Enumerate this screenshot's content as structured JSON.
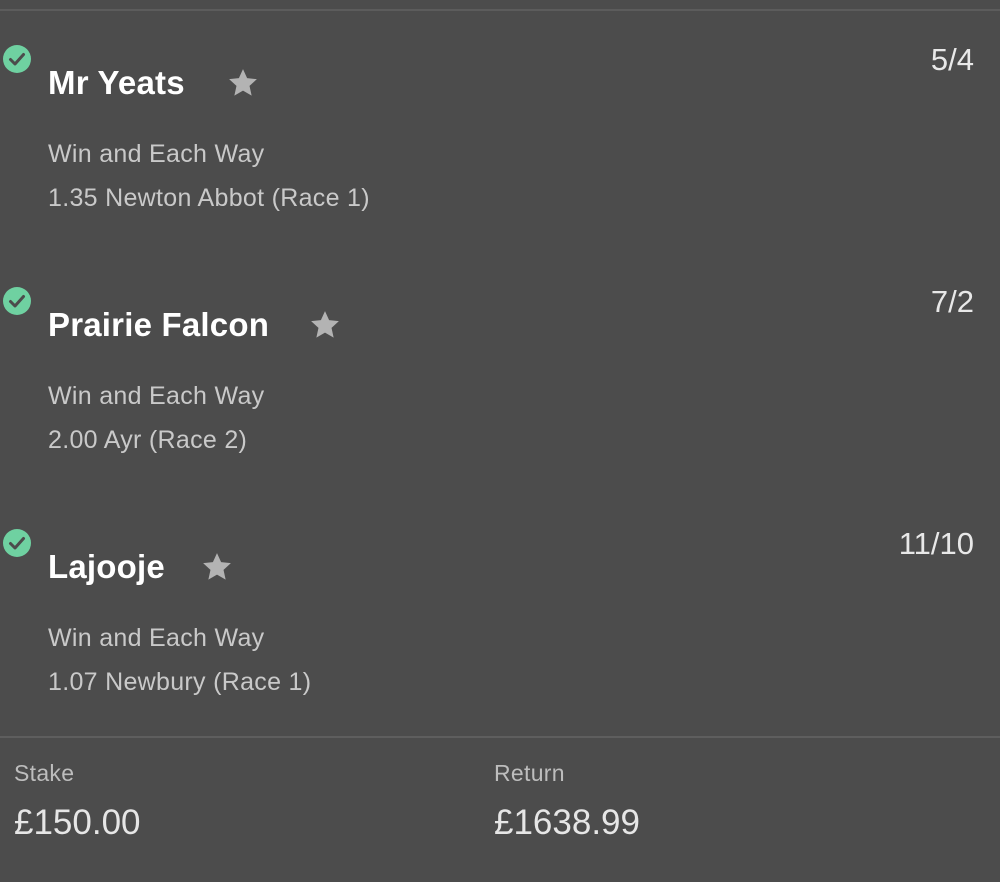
{
  "selections": [
    {
      "runner": "Mr Yeats",
      "odds": "5/4",
      "market": "Win and Each Way",
      "event": "1.35 Newton Abbot (Race 1)",
      "status_icon": "check-icon",
      "favourite_icon": "star-icon"
    },
    {
      "runner": "Prairie Falcon",
      "odds": "7/2",
      "market": "Win and Each Way",
      "event": "2.00 Ayr (Race 2)",
      "status_icon": "check-icon",
      "favourite_icon": "star-icon"
    },
    {
      "runner": "Lajooje",
      "odds": "11/10",
      "market": "Win and Each Way",
      "event": "1.07 Newbury (Race 1)",
      "status_icon": "check-icon",
      "favourite_icon": "star-icon"
    }
  ],
  "summary": {
    "stake_label": "Stake",
    "stake_value": "£150.00",
    "return_label": "Return",
    "return_value": "£1638.99"
  },
  "colors": {
    "background": "#4c4c4c",
    "win_check": "#6fd1a1",
    "star": "#b3b3b3"
  }
}
